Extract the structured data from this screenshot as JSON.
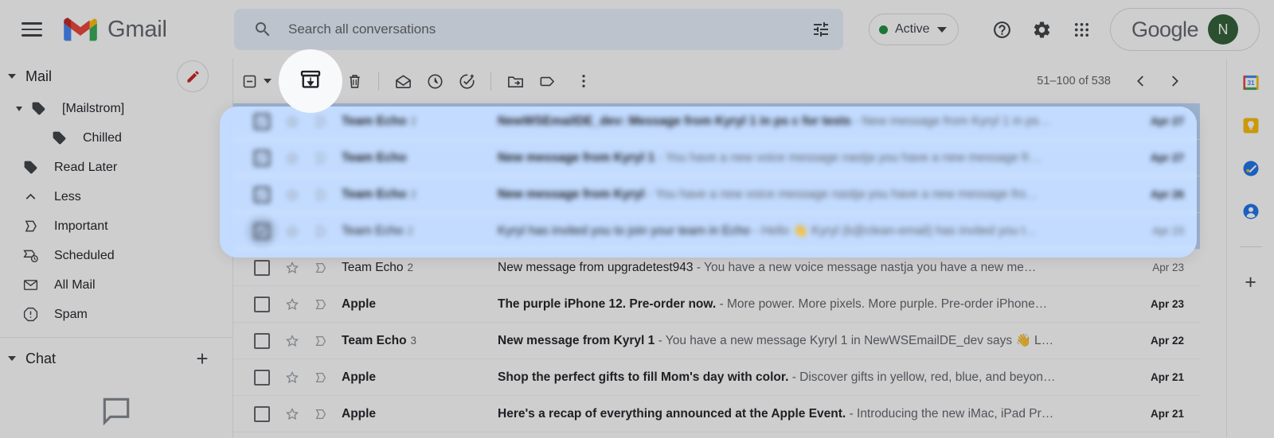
{
  "app": {
    "name": "Gmail",
    "brand_word": "Gmail",
    "logo_colors": [
      "#EA4335",
      "#4285F4",
      "#34A853",
      "#FBBC04",
      "#C5221F"
    ]
  },
  "header": {
    "menu_icon": "hamburger-icon",
    "search": {
      "placeholder": "Search all conversations",
      "value": "",
      "icon": "search-icon",
      "filter_icon": "tune-icon"
    },
    "status": {
      "label": "Active",
      "dot_color": "#1e8e3e",
      "caret": "chevron-down-icon"
    },
    "help_icon": "help-circle-icon",
    "settings_icon": "gear-icon",
    "apps_icon": "apps-grid-icon",
    "account": {
      "brand": "Google",
      "avatar_initial": "N",
      "avatar_color": "#2e5e33"
    }
  },
  "sidebar": {
    "mail_section": {
      "label": "Mail",
      "compose_icon": "compose-pencil-icon"
    },
    "items": [
      {
        "label": "[Mailstrom]",
        "icon": "label-tag-icon",
        "indent": 0,
        "expandable": true
      },
      {
        "label": "Chilled",
        "icon": "label-tag-icon",
        "indent": 1,
        "expandable": false
      },
      {
        "label": "Read Later",
        "icon": "label-tag-icon",
        "indent": 0,
        "expandable": false
      },
      {
        "label": "Less",
        "icon": "chevron-up-icon",
        "indent": 0,
        "expandable": false
      },
      {
        "label": "Important",
        "icon": "important-chevron-icon",
        "indent": 0,
        "expandable": false
      },
      {
        "label": "Scheduled",
        "icon": "scheduled-clock-icon",
        "indent": 0,
        "expandable": false
      },
      {
        "label": "All Mail",
        "icon": "all-mail-envelope-icon",
        "indent": 0,
        "expandable": false
      },
      {
        "label": "Spam",
        "icon": "spam-exclamation-icon",
        "indent": 0,
        "expandable": false
      }
    ],
    "chat_section": {
      "label": "Chat",
      "add_icon": "plus-icon",
      "empty_icon": "chat-bubble-icon"
    }
  },
  "toolbar": {
    "select_all_icon": "select-indeterminate-checkbox-icon",
    "select_all_caret": "chevron-down-icon",
    "archive_icon": "archive-box-icon",
    "report_spam_icon": "report-spam-icon",
    "delete_icon": "trash-icon",
    "mark_unread_icon": "mark-as-unread-icon",
    "snooze_icon": "snooze-clock-icon",
    "add_to_tasks_icon": "add-to-tasks-icon",
    "move_to_icon": "move-to-folder-icon",
    "labels_icon": "label-tag-icon",
    "more_icon": "more-vertical-icon",
    "pagination": {
      "range": "51–100 of 538",
      "prev_icon": "chevron-left-icon",
      "next_icon": "chevron-right-icon"
    }
  },
  "emails": [
    {
      "sender": "Team Echo",
      "count": "2",
      "subject": "NewWSEmailDE_dev: Message from Kyryl 1 in ps c for tests",
      "snippet": " - New message from Kyryl 1 in ps…",
      "date": "Apr 27",
      "unread": true,
      "selected": true,
      "checked": true,
      "blurred": true
    },
    {
      "sender": "Team Echo",
      "count": "",
      "subject": "New message from Kyryl 1",
      "snippet": " - You have a new voice message nastja you have a new message fr…",
      "date": "Apr 27",
      "unread": true,
      "selected": true,
      "checked": true,
      "blurred": true
    },
    {
      "sender": "Team Echo",
      "count": "2",
      "subject": "New message from Kyryl",
      "snippet": " - You have a new voice message nastja you have a new message fro…",
      "date": "Apr 26",
      "unread": true,
      "selected": true,
      "checked": true,
      "blurred": true
    },
    {
      "sender": "Team Echo",
      "count": "2",
      "subject": "Kyryl has invited you to join your team in Echo",
      "snippet": " - Hello 👋 Kyryl (k@clean-email) has invited you t…",
      "date": "Apr 23",
      "unread": false,
      "selected": true,
      "checked": true,
      "blurred": true
    },
    {
      "sender": "Team Echo",
      "count": "2",
      "subject": "New message from upgradetest943",
      "snippet": " - You have a new voice message nastja you have a new me…",
      "date": "Apr 23",
      "unread": false,
      "selected": false,
      "checked": false,
      "blurred": false
    },
    {
      "sender": "Apple",
      "count": "",
      "subject": "The purple iPhone 12. Pre-order now.",
      "snippet": " - More power. More pixels. More purple. Pre-order iPhone…",
      "date": "Apr 23",
      "unread": true,
      "selected": false,
      "checked": false,
      "blurred": false
    },
    {
      "sender": "Team Echo",
      "count": "3",
      "subject": "New message from Kyryl 1",
      "snippet": " - You have a new message Kyryl 1 in NewWSEmailDE_dev says 👋 L…",
      "date": "Apr 22",
      "unread": true,
      "selected": false,
      "checked": false,
      "blurred": false
    },
    {
      "sender": "Apple",
      "count": "",
      "subject": "Shop the perfect gifts to fill Mom's day with color.",
      "snippet": " - Discover gifts in yellow, red, blue, and beyon…",
      "date": "Apr 21",
      "unread": true,
      "selected": false,
      "checked": false,
      "blurred": false
    },
    {
      "sender": "Apple",
      "count": "",
      "subject": "Here's a recap of everything announced at the Apple Event.",
      "snippet": " - Introducing the new iMac, iPad Pr…",
      "date": "Apr 21",
      "unread": true,
      "selected": false,
      "checked": false,
      "blurred": false
    }
  ],
  "right_rail": {
    "items": [
      {
        "icon": "google-calendar-icon",
        "label": "Calendar",
        "badge": "31"
      },
      {
        "icon": "google-keep-icon",
        "label": "Keep"
      },
      {
        "icon": "google-tasks-icon",
        "label": "Tasks"
      },
      {
        "icon": "google-contacts-icon",
        "label": "Contacts"
      }
    ],
    "add_icon": "plus-icon"
  },
  "spotlight": {
    "target": "archive-button",
    "highlight_color": "#f8f9fa",
    "selection_color": "#c2dbff"
  }
}
